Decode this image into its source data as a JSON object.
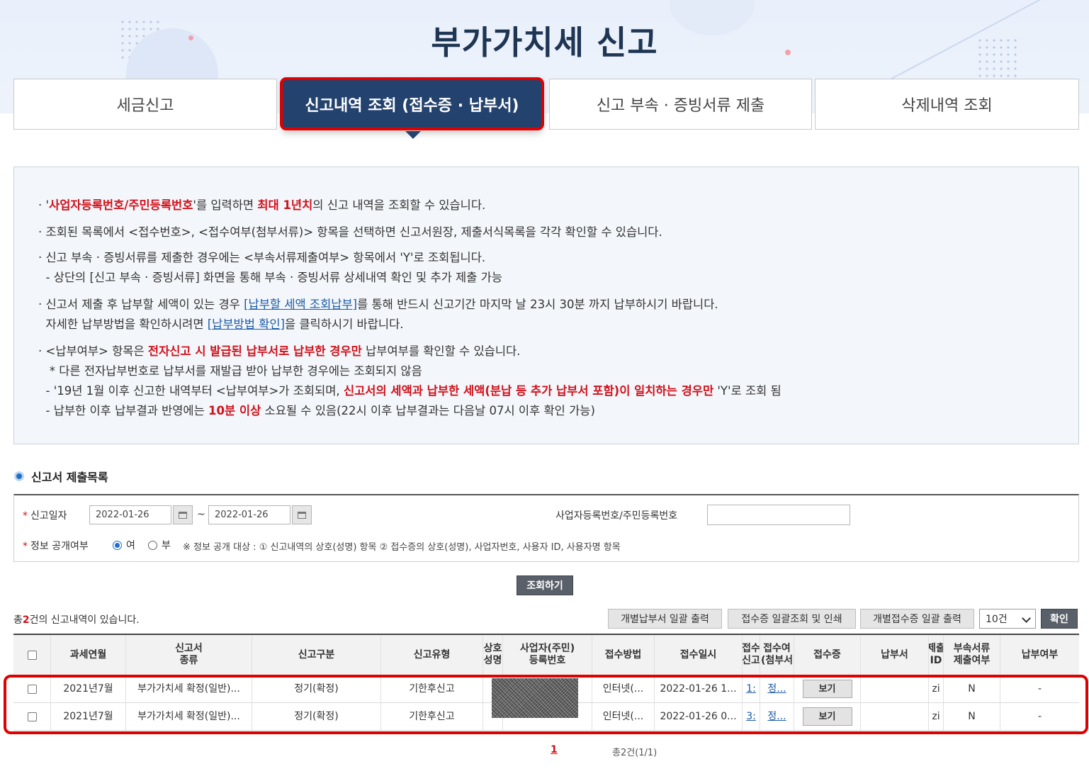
{
  "page_title": "부가가치세 신고",
  "tabs": [
    {
      "label": "세금신고",
      "active": false
    },
    {
      "label": "신고내역 조회 (접수증 · 납부서)",
      "active": true
    },
    {
      "label": "신고 부속 · 증빙서류 제출",
      "active": false
    },
    {
      "label": "삭제내역 조회",
      "active": false
    }
  ],
  "notice": {
    "l1_a": "· '",
    "l1_red": "사업자등록번호/주민등록번호",
    "l1_b": "'를 입력하면 ",
    "l1_red2": "최대 1년치",
    "l1_c": "의 신고 내역을 조회할 수 있습니다.",
    "l2": "· 조회된 목록에서 <접수번호>, <접수여부(첨부서류)> 항목을 선택하면 신고서원장, 제출서식목록을 각각 확인할 수 있습니다.",
    "l3": "· 신고 부속 · 증빙서류를 제출한 경우에는 <부속서류제출여부> 항목에서 'Y'로 조회됩니다.",
    "l4": "  - 상단의 [신고 부속 · 증빙서류] 화면을 통해 부속 · 증빙서류 상세내역 확인 및 추가 제출 가능",
    "l5_a": "· 신고서 제출 후 납부할 세액이 있는 경우 ",
    "l5_link": "[납부할 세액 조회납부]",
    "l5_b": "를 통해 반드시 신고기간 마지막 날 23시 30분 까지 납부하시기 바랍니다.",
    "l6_a": "  자세한 납부방법을 확인하시려면 ",
    "l6_link": "[납부방법 확인]",
    "l6_b": "을 클릭하시기 바랍니다.",
    "l7_a": "· <납부여부> 항목은 ",
    "l7_red": "전자신고 시 발급된 납부서로 납부한 경우만",
    "l7_b": " 납부여부를 확인할 수 있습니다.",
    "l8": "   * 다른 전자납부번호로 납부서를 재발급 받아 납부한 경우에는 조회되지 않음",
    "l9_a": "  - '19년 1월 이후 신고한 내역부터 <납부여부>가 조회되며, ",
    "l9_red": "신고서의 세액과 납부한 세액(분납 등 추가 납부서 포함)이 일치하는 경우만",
    "l9_b": " 'Y'로 조회 됨",
    "l10_a": "  - 납부한 이후 납부결과 반영에는 ",
    "l10_red": "10분 이상",
    "l10_b": " 소요될 수 있음(22시 이후 납부결과는 다음날 07시 이후 확인 가능)"
  },
  "section_title": "신고서 제출목록",
  "search": {
    "date_label": "신고일자",
    "date_from": "2022-01-26",
    "tilde": "~",
    "date_to": "2022-01-26",
    "reg_label": "사업자등록번호/주민등록번호",
    "reg_value": "",
    "public_label": "정보 공개여부",
    "opt_yes": "여",
    "opt_no": "부",
    "public_note": "※ 정보 공개 대상 : ① 신고내역의 상호(성명) 항목 ② 접수증의 상호(성명), 사업자번호, 사용자 ID, 사용자명 항목",
    "search_btn": "조회하기"
  },
  "result": {
    "count_prefix": "총",
    "count_num": "2",
    "count_suffix": "건의 신고내역이 있습니다.",
    "btn1": "개별납부서 일괄 출력",
    "btn2": "접수증 일괄조회 및 인쇄",
    "btn3": "개별접수증 일괄 출력",
    "page_size": "10건",
    "confirm_btn": "확인"
  },
  "table": {
    "headers": [
      "",
      "과세연월",
      "신고서\n종류",
      "신고구분",
      "신고유형",
      "상호\n(성명)",
      "사업자(주민)\n등록번호",
      "접수방법",
      "접수일시",
      "접수\n(신고)",
      "접수여\n(첨부서",
      "접수증",
      "납부서",
      "제출\nID",
      "부속서류\n제출여부",
      "납부여부"
    ],
    "rows": [
      {
        "period": "2021년7월",
        "type": "부가가치세 확정(일반)...",
        "category": "정기(확정)",
        "kind": "기한후신고",
        "method": "인터넷(...",
        "datetime": "2022-01-26 1...",
        "receipt_no": "1:",
        "attach": "정...",
        "view": "보기",
        "pay_doc": "",
        "id": "zi",
        "sub": "N",
        "paid": "-"
      },
      {
        "period": "2021년7월",
        "type": "부가가치세 확정(일반)...",
        "category": "정기(확정)",
        "kind": "기한후신고",
        "method": "인터넷(...",
        "datetime": "2022-01-26 0...",
        "receipt_no": "3:",
        "attach": "정...",
        "view": "보기",
        "pay_doc": "",
        "id": "zi",
        "sub": "N",
        "paid": "-"
      }
    ]
  },
  "pager": {
    "current": "1",
    "total": "총2건(1/1)"
  },
  "colors": {
    "accent": "#24426e",
    "highlight": "#e00000",
    "red_text": "#d0111b"
  }
}
